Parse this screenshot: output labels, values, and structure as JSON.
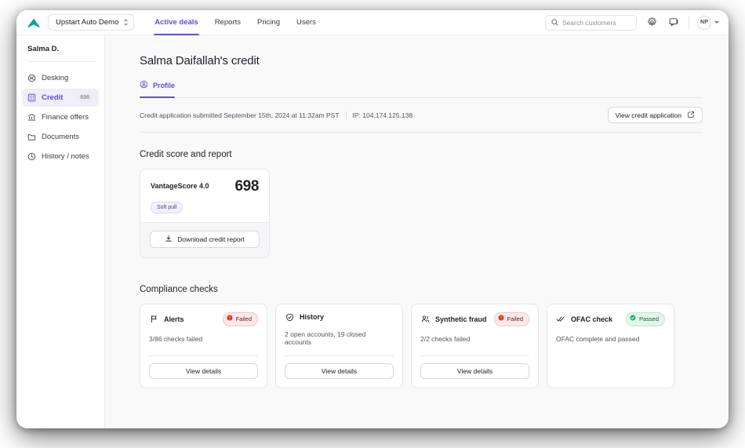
{
  "topbar": {
    "logo_icon": "upstart-chevron-logo",
    "org_selector": {
      "label": "Upstart Auto Demo",
      "icon": "chevron-updown-icon"
    },
    "nav": [
      {
        "label": "Active deals",
        "active": true
      },
      {
        "label": "Reports",
        "active": false
      },
      {
        "label": "Pricing",
        "active": false
      },
      {
        "label": "Users",
        "active": false
      }
    ],
    "search": {
      "placeholder": "Search customers",
      "value": "",
      "icon": "search-icon"
    },
    "settings_icon": "gear-icon",
    "messages_icon": "chat-icon",
    "avatar_initials": "NP",
    "avatar_caret_icon": "chevron-down-icon"
  },
  "sidebar": {
    "user": "Salma D.",
    "items": [
      {
        "label": "Desking",
        "icon": "desking-icon",
        "badge": "",
        "active": false
      },
      {
        "label": "Credit",
        "icon": "credit-icon",
        "badge": "698",
        "active": true
      },
      {
        "label": "Finance offers",
        "icon": "bank-icon",
        "badge": "",
        "active": false
      },
      {
        "label": "Documents",
        "icon": "folder-icon",
        "badge": "",
        "active": false
      },
      {
        "label": "History / notes",
        "icon": "clock-icon",
        "badge": "",
        "active": false
      }
    ]
  },
  "main": {
    "page_title": "Salma Daifallah's credit",
    "tabs": [
      {
        "label": "Profile",
        "icon": "person-circle-icon",
        "active": true
      }
    ],
    "application_info": {
      "submitted_text": "Credit application submitted September 15th, 2024 at 11:32am PST",
      "ip_text": "IP: 104.174.125.138",
      "view_button": {
        "label": "View credit application",
        "icon": "external-link-icon"
      }
    },
    "credit_section": {
      "title": "Credit score and report",
      "card": {
        "score_name": "VantageScore 4.0",
        "score_value": "698",
        "pull_type": "Soft pull",
        "download_button": {
          "label": "Download credit report",
          "icon": "download-icon"
        }
      }
    },
    "compliance_section": {
      "title": "Compliance checks",
      "cards": [
        {
          "title": "Alerts",
          "icon": "flag-icon",
          "status": "Failed",
          "status_type": "failed",
          "status_icon": "error-circle-icon",
          "description": "3/86 checks failed",
          "action_label": "View details",
          "has_action": true
        },
        {
          "title": "History",
          "icon": "shield-check-icon",
          "status": "",
          "status_type": "none",
          "status_icon": "",
          "description": "2 open accounts, 19 closed accounts",
          "action_label": "View details",
          "has_action": true
        },
        {
          "title": "Synthetic fraud",
          "icon": "users-icon",
          "status": "Failed",
          "status_type": "failed",
          "status_icon": "error-circle-icon",
          "description": "2/2 checks failed",
          "action_label": "View details",
          "has_action": true
        },
        {
          "title": "OFAC check",
          "icon": "double-check-icon",
          "status": "Passed",
          "status_type": "passed",
          "status_icon": "check-circle-icon",
          "description": "OFAC complete and passed",
          "action_label": "",
          "has_action": false
        }
      ]
    }
  },
  "colors": {
    "accent": "#5b4fd6",
    "logo": "#16a394",
    "failed_bg": "#fde8e8",
    "failed_fg": "#d92d20",
    "passed_bg": "#e3f6ec",
    "passed_fg": "#17b26a",
    "content_bg": "#f9f9fa"
  }
}
